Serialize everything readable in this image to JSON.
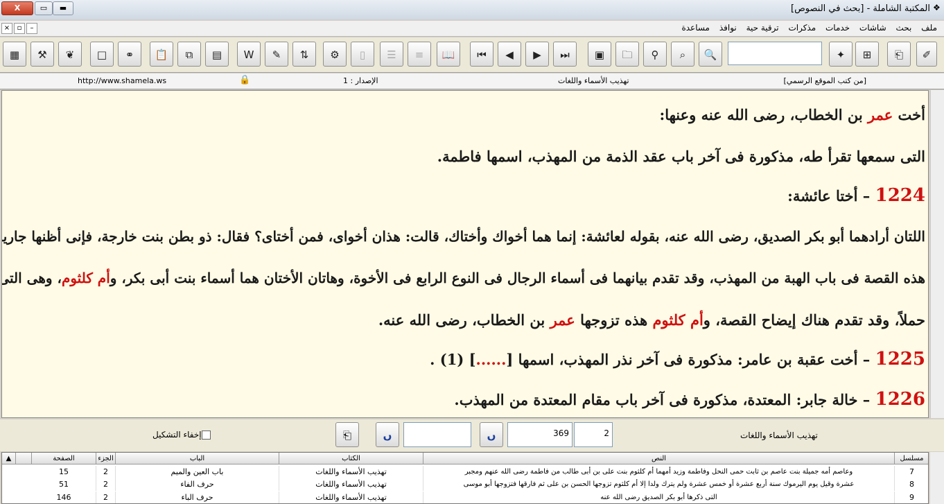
{
  "window": {
    "title": "المكتبة الشاملة - [بحث في النصوص]",
    "close_label": "X",
    "restore_label": "▭",
    "minimize_label": "▬"
  },
  "menu": {
    "items": [
      "ملف",
      "بحث",
      "شاشات",
      "خدمات",
      "مذكرات",
      "ترقية حية",
      "نوافذ",
      "مساعدة"
    ]
  },
  "infobar": {
    "source": "[من كتب الموقع الرسمي]",
    "book": "تهذيب الأسماء واللغات",
    "version": "الإصدار : 1",
    "website": "http://www.shamela.ws"
  },
  "content": {
    "line1": {
      "a": "أخت ",
      "b": "عمر",
      "c": " بن الخطاب، رضى الله عنه وعنها:"
    },
    "line2": "التى سمعها تقرأ طه، مذكورة فى آخر باب عقد الذمة من المهذب، اسمها فاطمة.",
    "line3": {
      "num": "1224",
      "rest": " – أختا عائشة:"
    },
    "line4": "اللتان أرادهما أبو بكر الصديق، رضى الله عنه، بقوله لعائشة: إنما هما أخواك وأختاك، قالت: هذان أخواى، فمن أختاى؟ فقال: ذو بطن بنت خارجة، فإنى أظنها جارية. ذكر",
    "line5": {
      "a": "هذه القصة فى باب الهبة من المهذب، وقد تقدم بيانهما فى أسماء الرجال فى النوع الرابع فى الأخوة، وهاتان الأختان هما أسماء بنت أبى بكر، و",
      "b": "أم كلثوم",
      "c": "، وهى التى كانت"
    },
    "line6": {
      "a": "حملاً، وقد تقدم هناك إيضاح القصة، و",
      "b": "أم كلثوم",
      "c": " هذه تزوجها ",
      "d": "عمر",
      "e": " بن الخطاب، رضى الله عنه."
    },
    "line7": {
      "num": "1225",
      "a": " – أخت عقبة بن عامر: مذكورة فى آخر نذر المهذب، اسمها [",
      "b": "......",
      "c": "] (1) ."
    },
    "line8": {
      "num": "1226",
      "rest": " – خالة جابر: المعتدة، مذكورة فى آخر باب مقام المعتدة من المهذب."
    }
  },
  "bottombar": {
    "book_title": "تهذيب الأسماء واللغات",
    "volume": "2",
    "page": "369",
    "hide_tashkeel_label": "إخفاء التشكيل",
    "hide_tashkeel_checked": false
  },
  "results": {
    "headers": {
      "serial": "مسلسل",
      "text": "النص",
      "book": "الكتاب",
      "chapter": "الباب",
      "volume": "الجزء",
      "page": "الصفحة"
    },
    "rows": [
      {
        "serial": "7",
        "text": "وعاصم أمه جميلة بنت عاصم بن ثابت حمى النحل وفاطمة وزيد أمهما أم كلثوم بنت على بن أبى طالب من فاطمة رضى الله عنهم ومجبر",
        "book": "تهذيب الأسماء واللغات",
        "chapter": "باب العين والميم",
        "volume": "2",
        "page": "15"
      },
      {
        "serial": "8",
        "text": "عشرة وقيل يوم اليرموك سنة أربع عشرة أو خمس عشرة ولم يترك ولدا إلا أم كلثوم تزوجها الحسن بن على ثم فارقها فتزوجها أبو موسى",
        "book": "تهذيب الأسماء واللغات",
        "chapter": "حرف الفاء",
        "volume": "2",
        "page": "51"
      },
      {
        "serial": "9",
        "text": "التى ذكرها أبو بكر الصديق رضى الله عنه",
        "book": "تهذيب الأسماء واللغات",
        "chapter": "حرف الباء",
        "volume": "2",
        "page": "146"
      }
    ]
  }
}
